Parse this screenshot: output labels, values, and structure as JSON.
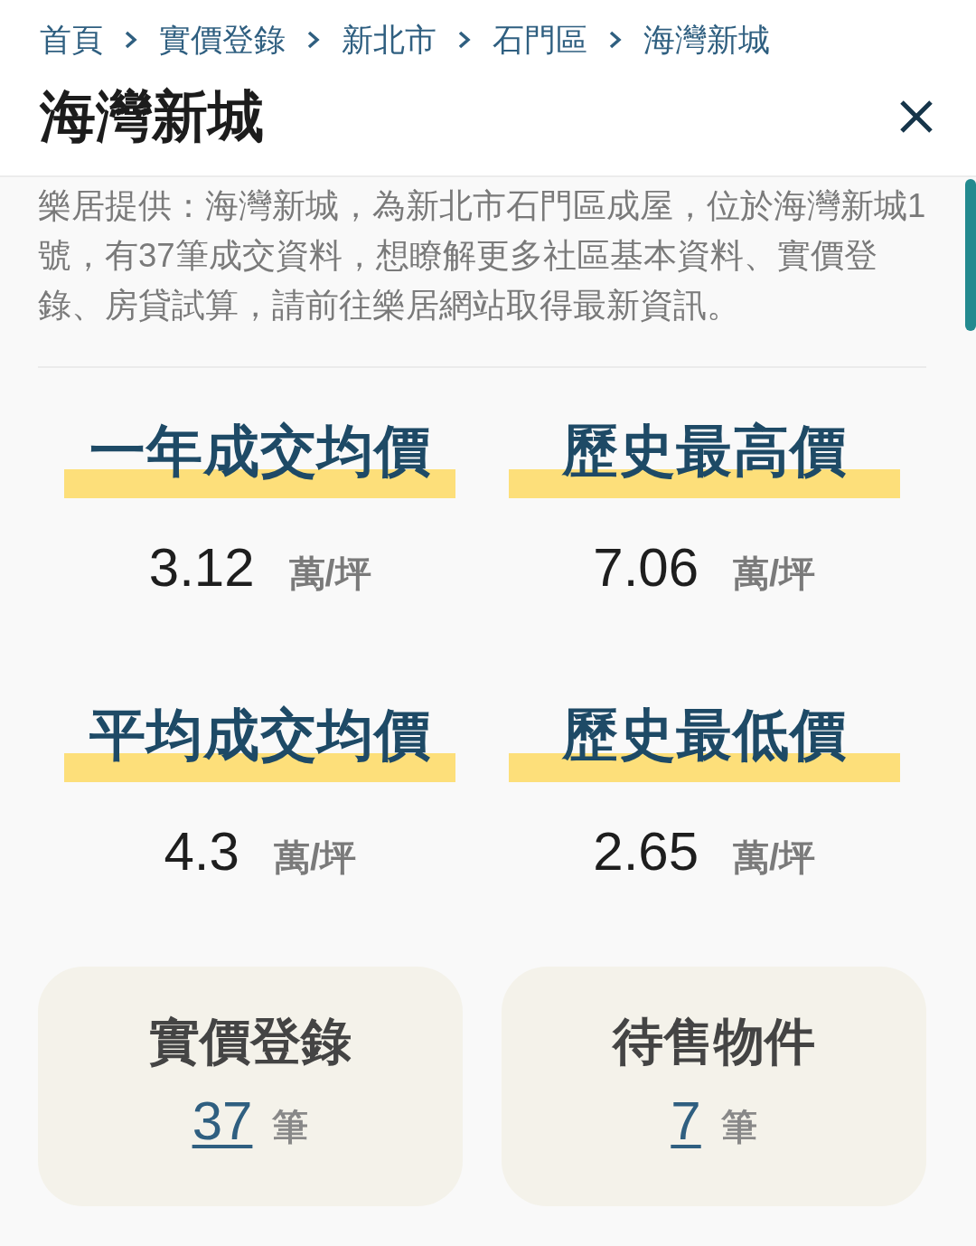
{
  "breadcrumb": [
    {
      "label": "首頁"
    },
    {
      "label": "實價登錄"
    },
    {
      "label": "新北市"
    },
    {
      "label": "石門區"
    },
    {
      "label": "海灣新城"
    }
  ],
  "title": "海灣新城",
  "description": "樂居提供：海灣新城，為新北市石門區成屋，位於海灣新城1號，有37筆成交資料，想瞭解更多社區基本資料、實價登錄、房貸試算，請前往樂居網站取得最新資訊。",
  "stats": [
    {
      "label": "一年成交均價",
      "value": "3.12",
      "unit": "萬/坪"
    },
    {
      "label": "歷史最高價",
      "value": "7.06",
      "unit": "萬/坪"
    },
    {
      "label": "平均成交均價",
      "value": "4.3",
      "unit": "萬/坪"
    },
    {
      "label": "歷史最低價",
      "value": "2.65",
      "unit": "萬/坪"
    }
  ],
  "cards": [
    {
      "title": "實價登錄",
      "count": "37",
      "unit": "筆"
    },
    {
      "title": "待售物件",
      "count": "7",
      "unit": "筆"
    }
  ]
}
